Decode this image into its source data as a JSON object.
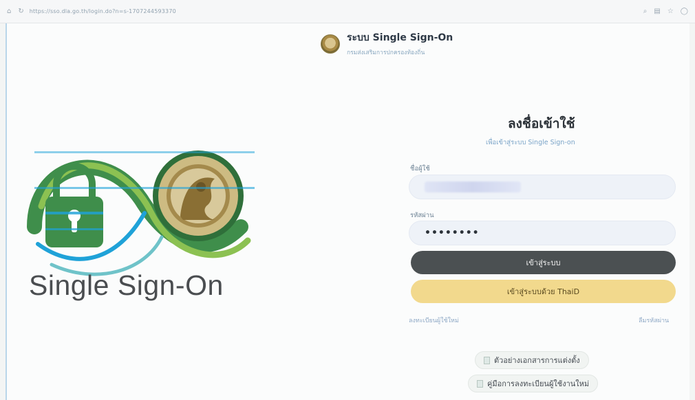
{
  "browser": {
    "url": "https://sso.dla.go.th/login.do?n=s-1707244593370"
  },
  "brand": {
    "title": "ระบบ Single Sign-On",
    "subtitle": "กรมส่งเสริมการปกครองท้องถิ่น"
  },
  "logo": {
    "text": "Single Sign-On",
    "colors": {
      "green": "#3f8e4b",
      "light_green": "#8cc152",
      "blue": "#1fa2d8",
      "grey_text": "#4a4d50"
    }
  },
  "form": {
    "title": "ลงชื่อเข้าใช้",
    "subtitle": "เพื่อเข้าสู่ระบบ Single Sign-on",
    "username_label": "ชื่อผู้ใช้",
    "password_label": "รหัสผ่าน",
    "password_value": "••••••••",
    "login_button": "เข้าสู่ระบบ",
    "thaid_button": "เข้าสู่ระบบด้วย ThaiD",
    "register_link": "ลงทะเบียนผู้ใช้ใหม่",
    "forgot_link": "ลืมรหัสผ่าน"
  },
  "links": {
    "appointment_sample": "ตัวอย่างเอกสารการแต่งตั้ง",
    "registration_manual": "คู่มือการลงทะเบียนผู้ใช้งานใหม่"
  }
}
